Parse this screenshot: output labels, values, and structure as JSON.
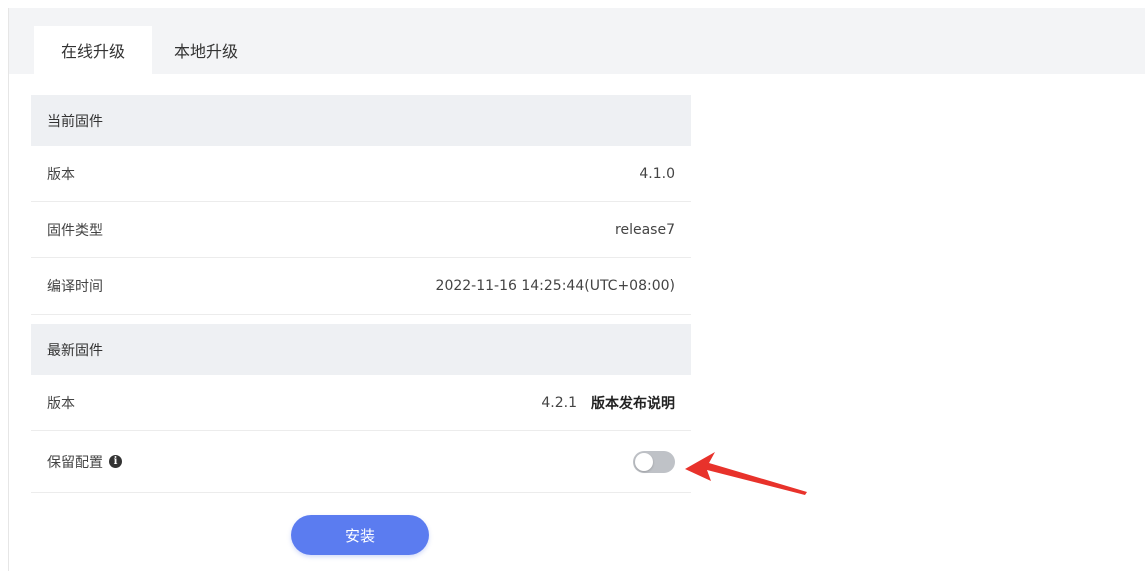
{
  "tabs": [
    {
      "label": "在线升级",
      "active": true
    },
    {
      "label": "本地升级",
      "active": false
    }
  ],
  "current_firmware": {
    "header": "当前固件",
    "rows": [
      {
        "label": "版本",
        "value": "4.1.0"
      },
      {
        "label": "固件类型",
        "value": "release7"
      },
      {
        "label": "编译时间",
        "value": "2022-11-16 14:25:44(UTC+08:00)"
      }
    ]
  },
  "latest_firmware": {
    "header": "最新固件",
    "version_label": "版本",
    "version_value": "4.2.1",
    "release_notes_link": "版本发布说明",
    "keep_config_label": "保留配置",
    "keep_config_enabled": false
  },
  "install_button": "安装",
  "colors": {
    "accent": "#5b7cf0",
    "annotation_arrow": "#e8322b",
    "toggle_off": "#bfc2c7"
  },
  "icons": {
    "info": "info-icon",
    "annotation": "red-arrow-annotation"
  }
}
